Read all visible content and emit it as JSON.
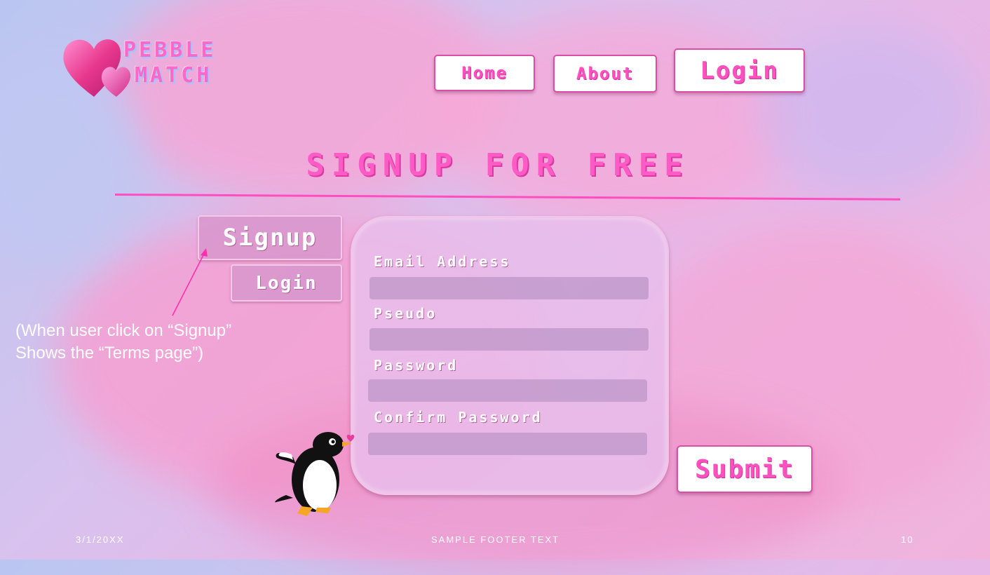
{
  "brand": {
    "line1": "PEBBLE",
    "line2": "MATCH"
  },
  "nav": {
    "home": "Home",
    "about": "About",
    "login": "Login"
  },
  "headline": "SIGNUP FOR FREE",
  "tabs": {
    "signup": "Signup",
    "login": "Login"
  },
  "annotation": {
    "line1": "(When user click on “Signup”",
    "line2": "Shows the “Terms page”)"
  },
  "form": {
    "fields": [
      {
        "label": "Email Address",
        "value": ""
      },
      {
        "label": "Pseudo",
        "value": ""
      },
      {
        "label": "Password",
        "value": ""
      },
      {
        "label": "Confirm Password",
        "value": ""
      }
    ]
  },
  "submit": "Submit",
  "footer": {
    "date": "3/1/20XX",
    "text": "SAMPLE FOOTER TEXT",
    "page": "10"
  },
  "colors": {
    "accent": "#ff5bc7",
    "border": "#d84fa8",
    "card": "#e8beeb"
  },
  "icons": {
    "logo": "hearts-logo-icon",
    "mascot": "penguin-icon"
  }
}
